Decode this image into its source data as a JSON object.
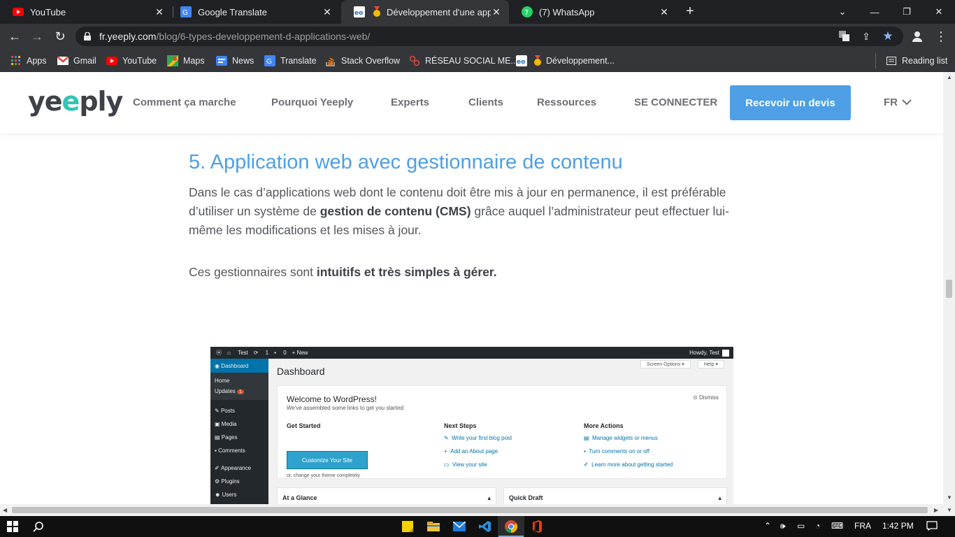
{
  "browser": {
    "tabs": [
      {
        "title": "YouTube",
        "favicon": "youtube-icon"
      },
      {
        "title": "Google Translate",
        "favicon": "google-translate-icon"
      },
      {
        "title": "Développement d'une applic",
        "favicon": "yeeply-icon",
        "active": true
      },
      {
        "title": "(7) WhatsApp",
        "favicon": "whatsapp-icon"
      }
    ],
    "url_domain": "fr.yeeply.com",
    "url_path": "/blog/6-types-developpement-d-applications-web/",
    "bookmarks": [
      {
        "label": "Apps",
        "icon": "apps-grid-icon"
      },
      {
        "label": "Gmail",
        "icon": "gmail-icon"
      },
      {
        "label": "YouTube",
        "icon": "youtube-icon"
      },
      {
        "label": "Maps",
        "icon": "maps-icon"
      },
      {
        "label": "News",
        "icon": "news-icon"
      },
      {
        "label": "Translate",
        "icon": "google-translate-icon"
      },
      {
        "label": "Stack Overflow",
        "icon": "stackoverflow-icon"
      },
      {
        "label": "RÉSEAU SOCIAL ME...",
        "icon": "network-icon"
      },
      {
        "label": "Développement...",
        "icon": "yeeply-icon"
      }
    ],
    "reading_list": "Reading list"
  },
  "site": {
    "logo": {
      "pre": "ye",
      "accent": "e",
      "post": "ply"
    },
    "nav": [
      "Comment ça marche",
      "Pourquoi Yeeply",
      "Experts",
      "Clients",
      "Ressources"
    ],
    "login": "SE CONNECTER",
    "cta": "Recevoir un devis",
    "lang": "FR",
    "colors": {
      "accent": "#4e9fe5",
      "logo_accent": "#34c3b6"
    }
  },
  "article": {
    "heading": "5. Application web avec gestionnaire de contenu",
    "p1_a": "Dans le cas d’applications web dont le contenu doit être mis à jour en permanence, il est préférable d’utiliser un système de ",
    "p1_b": "gestion de contenu (CMS)",
    "p1_c": " grâce auquel l’administrateur peut effectuer lui-même les modifications et les mises à jour.",
    "p2_a": "Ces gestionnaires sont ",
    "p2_b": "intuitifs et très simples à gérer."
  },
  "wp": {
    "adminbar_site": "Test",
    "adminbar_updates": "1",
    "adminbar_comments": "0",
    "adminbar_new": "+ New",
    "howdy": "Howdy, Test",
    "menu_dashboard": "Dashboard",
    "menu_home": "Home",
    "menu_updates": "Updates",
    "menu_updates_count": "1",
    "menu": [
      "Posts",
      "Media",
      "Pages",
      "Comments",
      "Appearance",
      "Plugins",
      "Users"
    ],
    "title": "Dashboard",
    "screen_options": "Screen Options ▾",
    "help": "Help ▾",
    "welcome": "Welcome to WordPress!",
    "welcome_sub": "We've assembled some links to get you started:",
    "dismiss": "Dismiss",
    "get_started": "Get Started",
    "customize": "Customize Your Site",
    "or_change": "or, change your theme completely",
    "next_steps": "Next Steps",
    "next": [
      "Write your first blog post",
      "Add an About page",
      "View your site"
    ],
    "more_actions": "More Actions",
    "more": [
      "Manage widgets or menus",
      "Turn comments on or off",
      "Learn more about getting started"
    ],
    "at_a_glance": "At a Glance",
    "quick_draft": "Quick Draft"
  },
  "taskbar": {
    "lang": "FRA",
    "time": "1:42 PM"
  }
}
